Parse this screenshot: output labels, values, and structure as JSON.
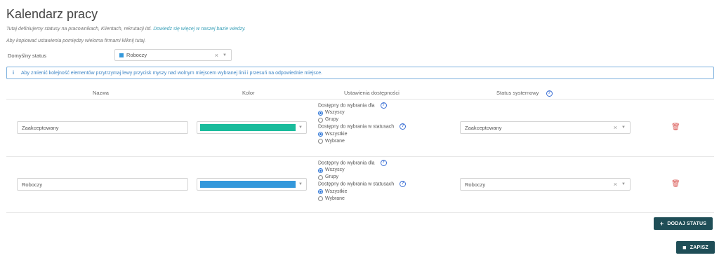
{
  "page": {
    "title": "Kalendarz pracy",
    "desc_text": "Tutaj definiujemy statusy na pracownikach, Klientach, rekrutacji itd.",
    "desc_link": "Dowiedz się więcej w naszej bazie wiedzy.",
    "copy_text": "Aby kopiować ustawienia pomiędzy wieloma firmami kliknij tutaj."
  },
  "default_status": {
    "label": "Domyślny status",
    "value": "Roboczy",
    "color": "#3498db"
  },
  "info_banner": {
    "icon": "info-icon",
    "text": "Aby zmienić kolejność elementów przytrzymaj lewy przycisk myszy nad wolnym miejscem wybranej linii i przesuń na odpowiednie miejsce."
  },
  "columns": {
    "name": "Nazwa",
    "color": "Kolor",
    "availability": "Ustawienia dostępności",
    "system_status": "Status systemowy"
  },
  "availability_labels": {
    "for_label": "Dostępny do wybrania dla",
    "opt_all": "Wszyscy",
    "opt_groups": "Grupy",
    "in_statuses_label": "Dostępny do wybrania w statusach",
    "opt_all_statuses": "Wszystkie",
    "opt_selected": "Wybrane"
  },
  "rows": [
    {
      "name": "Zaakceptowany",
      "color": "#1abc9c",
      "system_status": "Zaakceptowany"
    },
    {
      "name": "Roboczy",
      "color": "#3498db",
      "system_status": "Roboczy"
    }
  ],
  "buttons": {
    "add_status": "DODAJ STATUS",
    "save": "ZAPISZ"
  }
}
